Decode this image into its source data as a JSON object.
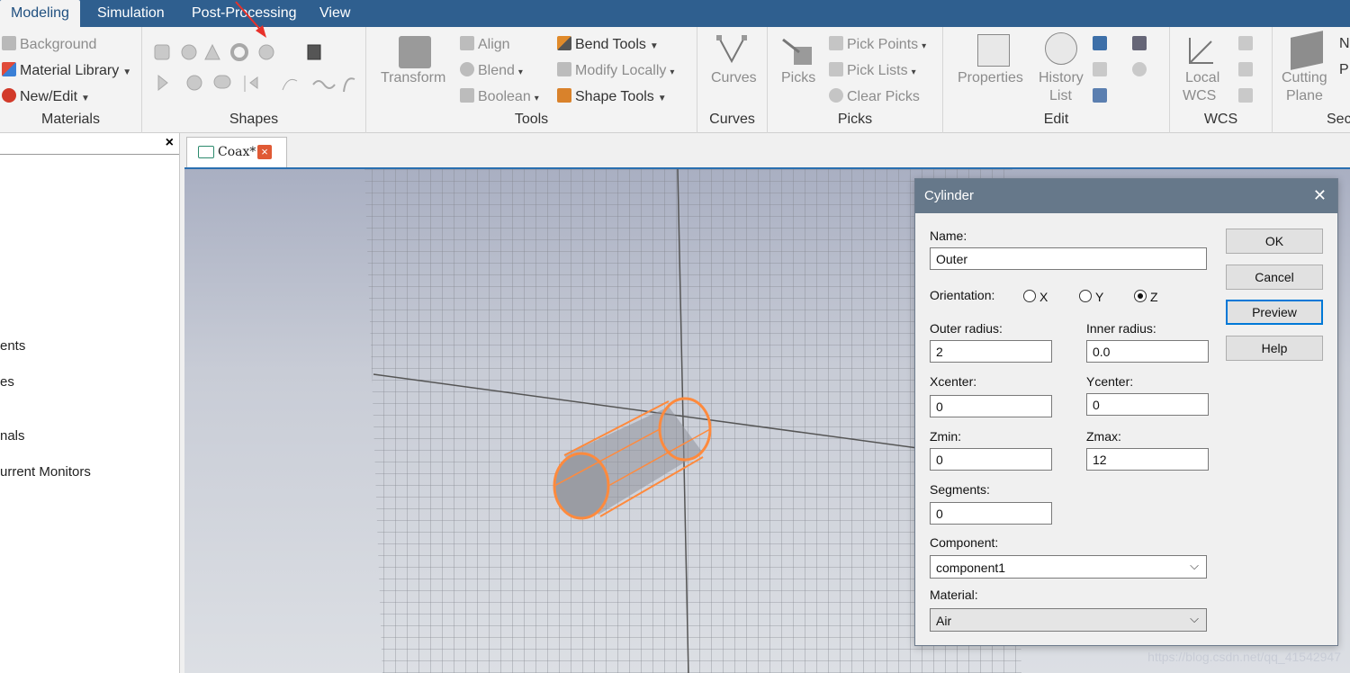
{
  "tabs": [
    "Modeling",
    "Simulation",
    "Post-Processing",
    "View"
  ],
  "ribbon": {
    "materials": {
      "background": "Background",
      "material_library": "Material Library",
      "new_edit": "New/Edit",
      "label": "Materials"
    },
    "shapes": {
      "label": "Shapes"
    },
    "tools": {
      "transform": "Transform",
      "align": "Align",
      "blend": "Blend",
      "boolean": "Boolean",
      "bend_tools": "Bend Tools",
      "modify_locally": "Modify Locally",
      "shape_tools": "Shape Tools",
      "label": "Tools"
    },
    "curves": {
      "curves": "Curves",
      "label": "Curves"
    },
    "picks": {
      "picks": "Picks",
      "pick_points": "Pick Points",
      "pick_lists": "Pick Lists",
      "clear_picks": "Clear Picks",
      "label": "Picks"
    },
    "edit": {
      "properties": "Properties",
      "history": "History",
      "list": "List",
      "label": "Edit"
    },
    "wcs": {
      "local": "Local",
      "wcs": "WCS",
      "label": "WCS"
    },
    "section": {
      "cutting": "Cutting",
      "plane": "Plane",
      "n": "N",
      "p": "P",
      "label": "Sec"
    }
  },
  "left_panel": {
    "close": "×",
    "items": [
      "ents",
      "es",
      "nals",
      "urrent Monitors"
    ]
  },
  "doc_tab": {
    "label": "Coax*",
    "close": "×"
  },
  "dialog": {
    "title": "Cylinder",
    "close": "✕",
    "name_label": "Name:",
    "name_value": "Outer",
    "orientation_label": "Orientation:",
    "orientation_options": [
      "X",
      "Y",
      "Z"
    ],
    "orientation_selected": "Z",
    "outer_radius_label": "Outer radius:",
    "outer_radius_value": "2",
    "inner_radius_label": "Inner radius:",
    "inner_radius_value": "0.0",
    "xcenter_label": "Xcenter:",
    "xcenter_value": "0",
    "ycenter_label": "Ycenter:",
    "ycenter_value": "0",
    "zmin_label": "Zmin:",
    "zmin_value": "0",
    "zmax_label": "Zmax:",
    "zmax_value": "12",
    "segments_label": "Segments:",
    "segments_value": "0",
    "component_label": "Component:",
    "component_value": "component1",
    "material_label": "Material:",
    "material_value": "Air",
    "buttons": {
      "ok": "OK",
      "cancel": "Cancel",
      "preview": "Preview",
      "help": "Help"
    }
  },
  "watermark": "https://blog.csdn.net/qq_41542947",
  "colors": {
    "accent": "#2f5f8f",
    "cylinder": "#ff8a3d",
    "annotation_arrow": "#e8312a"
  }
}
